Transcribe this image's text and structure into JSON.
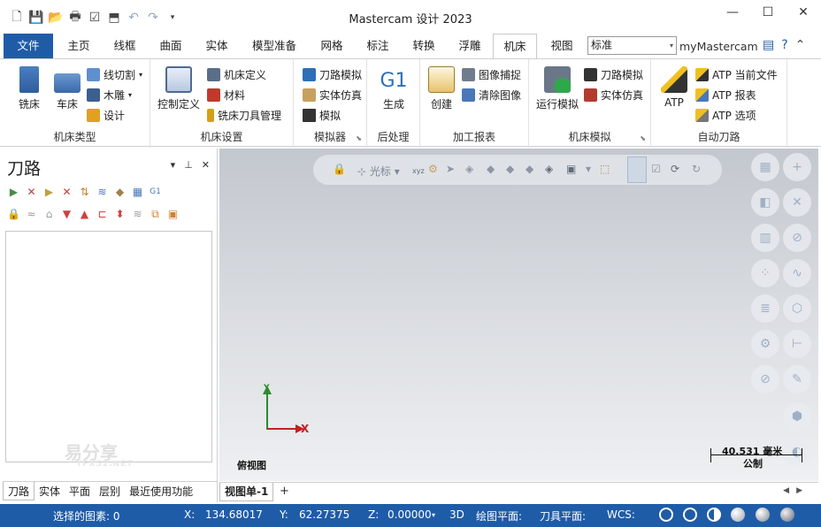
{
  "app": {
    "title": "Mastercam 设计 2023"
  },
  "tabs": [
    {
      "label": "文件"
    },
    {
      "label": "主页"
    },
    {
      "label": "线框"
    },
    {
      "label": "曲面"
    },
    {
      "label": "实体"
    },
    {
      "label": "模型准备"
    },
    {
      "label": "网格"
    },
    {
      "label": "标注"
    },
    {
      "label": "转换"
    },
    {
      "label": "浮雕"
    },
    {
      "label": "机床"
    },
    {
      "label": "视图"
    }
  ],
  "active_tab": "机床",
  "standard_select": "标准",
  "my_mastercam": "myMastercam",
  "ribbon": {
    "machine_type": {
      "label": "机床类型",
      "mill": "铣床",
      "lathe": "车床",
      "wire": "线切割",
      "router": "木雕",
      "design": "设计"
    },
    "machine_setup": {
      "label": "机床设置",
      "control": "控制定义",
      "machine_def": "机床定义",
      "material": "材料",
      "tool_mgr": "铣床刀具管理"
    },
    "simulator": {
      "label": "模拟器",
      "toolpath_sim": "刀路模拟",
      "solid_sim": "实体仿真",
      "simulate": "模拟"
    },
    "post": {
      "label": "后处理",
      "icon_text": "G1",
      "generate": "生成"
    },
    "report": {
      "label": "加工报表",
      "create": "创建",
      "capture": "图像捕捉",
      "clear": "清除图像"
    },
    "machine_sim": {
      "label": "机床模拟",
      "run": "运行模拟",
      "toolpath_sim": "刀路模拟",
      "solid_sim": "实体仿真"
    },
    "auto": {
      "label": "自动刀路",
      "atp": "ATP",
      "current": "ATP 当前文件",
      "report": "ATP 报表",
      "options": "ATP 选项"
    }
  },
  "panel": {
    "title": "刀路",
    "tabs": [
      {
        "label": "刀路"
      },
      {
        "label": "实体"
      },
      {
        "label": "平面"
      },
      {
        "label": "层别"
      },
      {
        "label": "最近使用功能"
      }
    ]
  },
  "watermark": {
    "text": "易分享",
    "sub": "YFX52.NET"
  },
  "viewport": {
    "toolbar_cursor": "光标",
    "toolbar_xyz": "xyz",
    "axis_x": "X",
    "axis_y": "Y",
    "view_name": "俯视图",
    "scale_value": "40.531 毫米",
    "scale_unit": "公制"
  },
  "sheets": {
    "active": "视图单-1",
    "add": "+"
  },
  "status": {
    "selected": "选择的图素: 0",
    "x_label": "X:",
    "x_value": "134.68017",
    "y_label": "Y:",
    "y_value": "62.27375",
    "z_label": "Z:",
    "z_value": "0.00000",
    "mode": "3D",
    "cplane": "绘图平面:",
    "tplane": "刀具平面:",
    "wcs": "WCS:"
  },
  "colors": {
    "accent": "#1f5ca8",
    "axis_x": "#c42121",
    "axis_y": "#2d8a2d"
  }
}
